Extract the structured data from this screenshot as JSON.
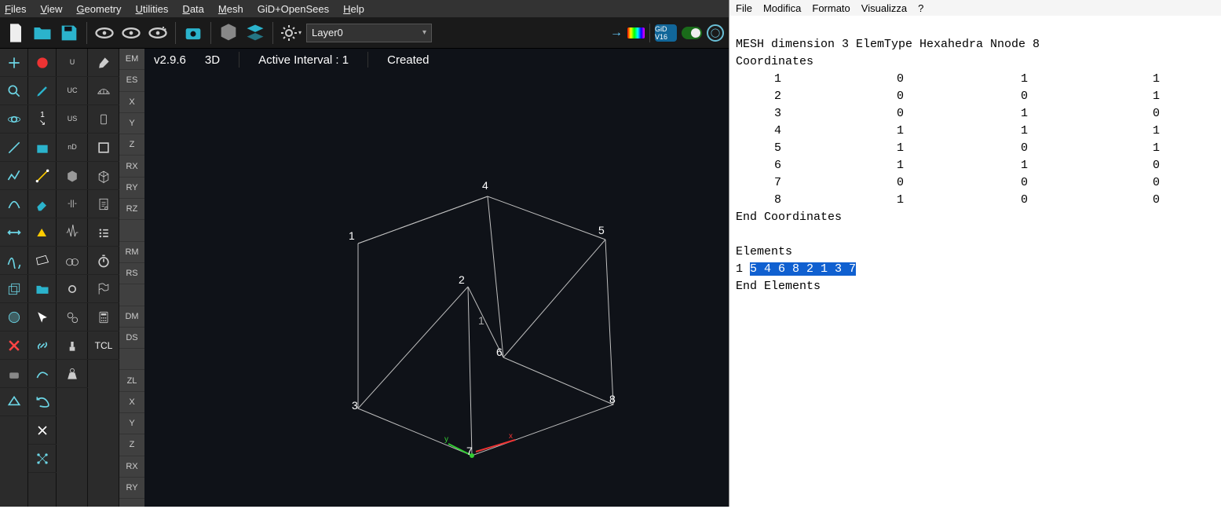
{
  "gid": {
    "menu": [
      "Files",
      "View",
      "Geometry",
      "Utilities",
      "Data",
      "Mesh",
      "GiD+OpenSees",
      "Help"
    ],
    "layer": "Layer0",
    "badge": "GiD V16",
    "status": {
      "version": "v2.9.6",
      "dim": "3D",
      "interval": "Active Interval :  1",
      "state": "Created"
    },
    "labels": [
      "EM",
      "ES",
      "X",
      "Y",
      "Z",
      "RX",
      "RY",
      "RZ",
      "",
      "RM",
      "RS",
      "",
      "DM",
      "DS",
      "",
      "ZL",
      "X",
      "Y",
      "Z",
      "RX",
      "RY"
    ],
    "pal_c": [
      "U",
      "UC",
      "US",
      "nD",
      "",
      "-||-",
      "",
      "",
      "",
      "",
      "",
      "",
      "",
      "",
      "TCL"
    ],
    "nodes": {
      "1": "1",
      "2": "2",
      "3": "3",
      "4": "4",
      "5": "5",
      "6": "6",
      "7": "7",
      "8": "8",
      "center": "1"
    }
  },
  "notepad": {
    "menu": [
      "File",
      "Modifica",
      "Formato",
      "Visualizza",
      "?"
    ],
    "header": "MESH dimension 3 ElemType Hexahedra Nnode 8",
    "coord_begin": "Coordinates",
    "coord_end": "End Coordinates",
    "coords": [
      [
        "1",
        "0",
        "1",
        "1"
      ],
      [
        "2",
        "0",
        "0",
        "1"
      ],
      [
        "3",
        "0",
        "1",
        "0"
      ],
      [
        "4",
        "1",
        "1",
        "1"
      ],
      [
        "5",
        "1",
        "0",
        "1"
      ],
      [
        "6",
        "1",
        "1",
        "0"
      ],
      [
        "7",
        "0",
        "0",
        "0"
      ],
      [
        "8",
        "1",
        "0",
        "0"
      ]
    ],
    "elem_begin": "Elements",
    "elem_line_prefix": "1 ",
    "elem_line_hl": "5 4 6 8 2 1 3 7",
    "elem_end": "End Elements"
  }
}
